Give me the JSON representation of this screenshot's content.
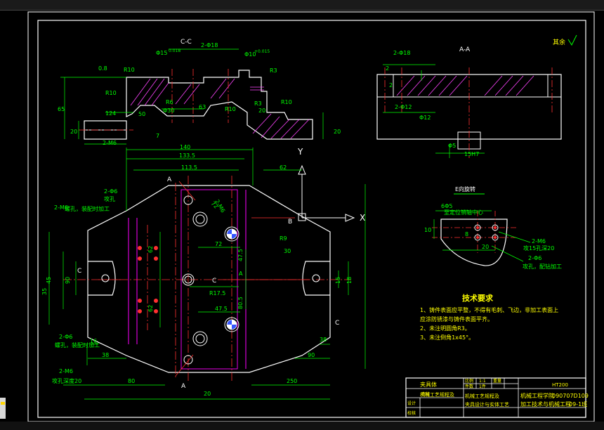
{
  "drawing": {
    "corner_note": "其余",
    "views": {
      "section_cc": "C-C",
      "section_aa": "A-A",
      "rotated_view": "E向旋转"
    },
    "dims_cc": [
      "2-Φ18",
      "Φ15",
      "0.018",
      "Φ10",
      "+0.015",
      "R3",
      "R10",
      "R6",
      "R10",
      "Φ30",
      "63",
      "R10",
      "R10",
      "124",
      "20",
      "20",
      "65",
      "2-M6",
      "50",
      "7",
      "0.8",
      "R3",
      "20"
    ],
    "dims_aa": [
      "2-Φ18",
      "2",
      "2-Φ12",
      "Φ12",
      "15H7",
      "Φ5",
      "2"
    ],
    "dims_plan": [
      "140",
      "133.5",
      "113.5",
      "62",
      "62",
      "62",
      "72",
      "72",
      "47.5",
      "47.5",
      "80.5",
      "R17.5",
      "R9",
      "30",
      "45",
      "90",
      "35",
      "18",
      "15",
      "16",
      "38",
      "38",
      "90",
      "80",
      "250",
      "20",
      "2-M6",
      "2-Φ6",
      "2-M6",
      "2-Φ6",
      "2-M6"
    ],
    "plan_notes": [
      "螺孔，装配时加工",
      "攻孔",
      "螺孔，装配时加工",
      "攻孔深度20",
      "攻孔深度20"
    ],
    "rotated_dims": [
      "6Φ5",
      "至定位销轴中心",
      "10",
      "8",
      "20",
      "2-M6",
      "攻15孔深20",
      "2-Φ6",
      "攻孔，配钻加工"
    ],
    "labels": [
      "A",
      "A",
      "B",
      "C",
      "C",
      "C",
      "E",
      "X",
      "Y"
    ]
  },
  "tech": {
    "title": "技术要求",
    "items": [
      "1、铸件表面应平整，不得有毛刺、飞边，非加工表面上",
      "   应涂防锈漆与铸件表面平齐。",
      "2、未注明圆角R3。",
      "3、未注倒角1x45°。"
    ]
  },
  "title_block": {
    "left_title": "夹具体",
    "col1": [
      "设计",
      "校核",
      "审核"
    ],
    "col2": [
      "比例",
      "1:1"
    ],
    "col3": [
      "件数",
      "1件"
    ],
    "col4": [
      "重量"
    ],
    "material": "HT200",
    "desc1": "机械工艺规程及",
    "desc2": "夹具设计与实体工艺",
    "school1": "机械工程学院",
    "school2": "加工技术与机械工程",
    "code1": "090707D109",
    "code2": "09-1班"
  },
  "colors": {
    "geometry": "#ffffff",
    "dimension": "#00ff00",
    "center": "#ff3030",
    "magenta": "#ff00ff",
    "cyan": "#00ffff",
    "yellow": "#ffff00",
    "hatch": "#ff44ff"
  }
}
